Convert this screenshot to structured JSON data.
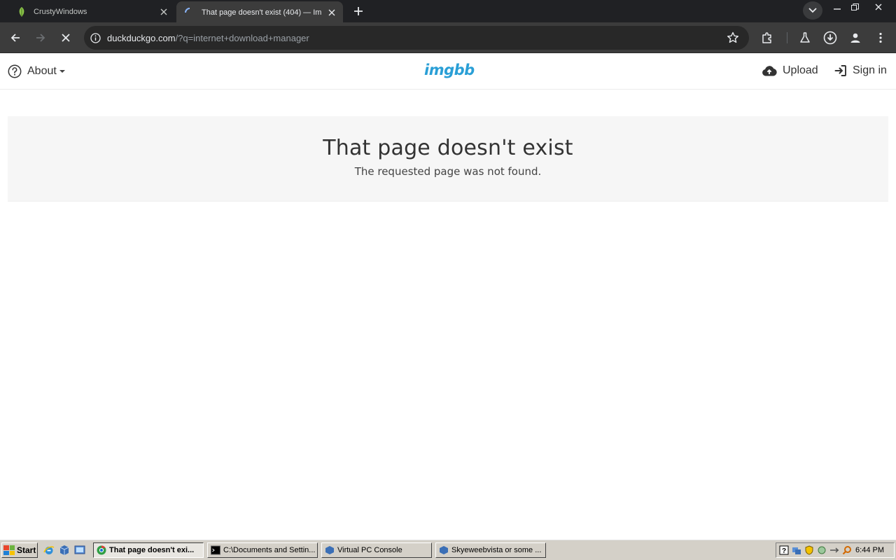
{
  "browser": {
    "tabs": [
      {
        "title": "CrustyWindows",
        "active": false
      },
      {
        "title": "That page doesn't exist (404) — Im",
        "active": true
      }
    ],
    "url_host": "duckduckgo.com",
    "url_rest": "/?q=internet+download+manager"
  },
  "site": {
    "logo": "imgbb",
    "about_label": "About",
    "upload_label": "Upload",
    "signin_label": "Sign in",
    "accent_color": "#2a9fd6"
  },
  "notice": {
    "title": "That page doesn't exist",
    "message": "The requested page was not found."
  },
  "taskbar": {
    "start_label": "Start",
    "tasks": [
      {
        "label": "That page doesn't exi...",
        "active": true
      },
      {
        "label": "C:\\Documents and Settin...",
        "active": false
      },
      {
        "label": "Virtual PC Console",
        "active": false
      },
      {
        "label": "Skyeweebvista or some ...",
        "active": false
      }
    ],
    "clock": "6:44 PM"
  }
}
